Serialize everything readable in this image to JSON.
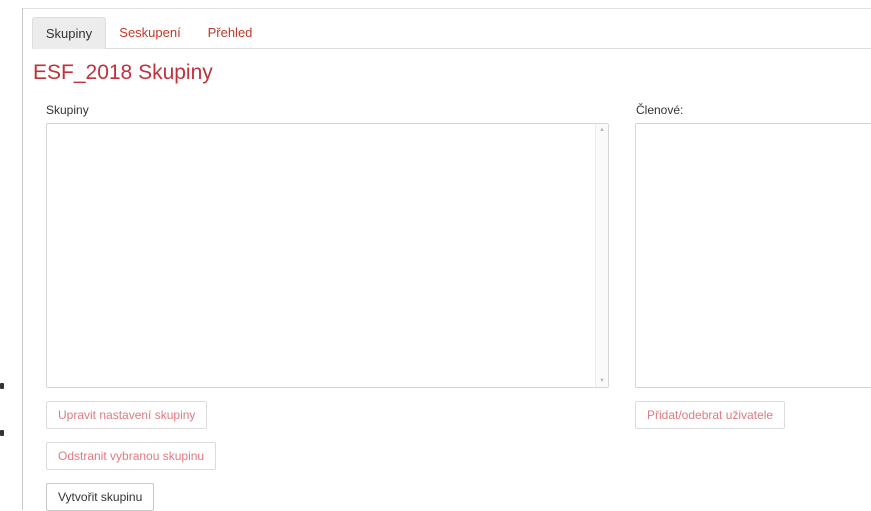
{
  "tabs": [
    {
      "label": "Skupiny",
      "active": true
    },
    {
      "label": "Seskupení",
      "active": false
    },
    {
      "label": "Přehled",
      "active": false
    }
  ],
  "page": {
    "title": "ESF_2018 Skupiny"
  },
  "groups": {
    "label": "Skupiny",
    "items": []
  },
  "members": {
    "label": "Členové:",
    "items": []
  },
  "actions": {
    "edit_group": "Upravit nastavení skupiny",
    "remove_group": "Odstranit vybranou skupinu",
    "create_group": "Vytvořit skupinu",
    "add_remove_users": "Přidat/odebrat uživatele"
  },
  "colors": {
    "accent": "#c1313b",
    "disabled_text": "#e07a80",
    "tab_active_bg": "#ececec"
  }
}
